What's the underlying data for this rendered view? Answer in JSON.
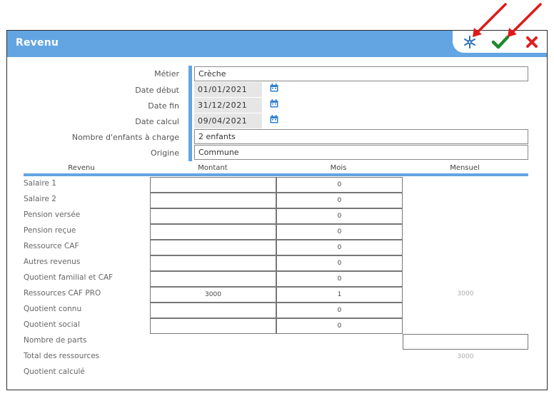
{
  "window": {
    "title": "Revenu"
  },
  "toolbar": {
    "settings_icon": "snowflake-gear-icon",
    "validate_icon": "checkmark-icon",
    "cancel_icon": "close-x-icon"
  },
  "colors": {
    "accent": "#62a5e2",
    "ok": "#1e8a2c",
    "cancel": "#e02020",
    "annotation": "#e01818"
  },
  "fields": {
    "metier": {
      "label": "Métier",
      "value": "Crèche"
    },
    "date_debut": {
      "label": "Date début",
      "value": "01/01/2021"
    },
    "date_fin": {
      "label": "Date fin",
      "value": "31/12/2021"
    },
    "date_calcul": {
      "label": "Date calcul",
      "value": "09/04/2021"
    },
    "enfants": {
      "label": "Nombre d'enfants à charge",
      "value": "2 enfants"
    },
    "origine": {
      "label": "Origine",
      "value": "Commune"
    }
  },
  "table": {
    "headers": {
      "revenu": "Revenu",
      "montant": "Montant",
      "mois": "Mois",
      "mensuel": "Mensuel"
    },
    "rows": [
      {
        "label": "Salaire 1",
        "montant": "",
        "mois": "0",
        "mensuel": ""
      },
      {
        "label": "Salaire 2",
        "montant": "",
        "mois": "0",
        "mensuel": ""
      },
      {
        "label": "Pension versée",
        "montant": "",
        "mois": "0",
        "mensuel": ""
      },
      {
        "label": "Pension reçue",
        "montant": "",
        "mois": "0",
        "mensuel": ""
      },
      {
        "label": "Ressource CAF",
        "montant": "",
        "mois": "0",
        "mensuel": ""
      },
      {
        "label": "Autres revenus",
        "montant": "",
        "mois": "0",
        "mensuel": ""
      },
      {
        "label": "Quotient familial et CAF",
        "montant": "",
        "mois": "0",
        "mensuel": ""
      },
      {
        "label": "Ressources CAF PRO",
        "montant": "3000",
        "mois": "1",
        "mensuel": "3000"
      },
      {
        "label": "Quotient connu",
        "montant": "",
        "mois": "0",
        "mensuel": ""
      },
      {
        "label": "Quotient social",
        "montant": "",
        "mois": "0",
        "mensuel": ""
      }
    ],
    "nombre_parts": {
      "label": "Nombre de parts",
      "value": ""
    },
    "total": {
      "label": "Total des ressources",
      "value": "3000"
    },
    "quotient_calcule": {
      "label": "Quotient calculé",
      "value": ""
    }
  }
}
